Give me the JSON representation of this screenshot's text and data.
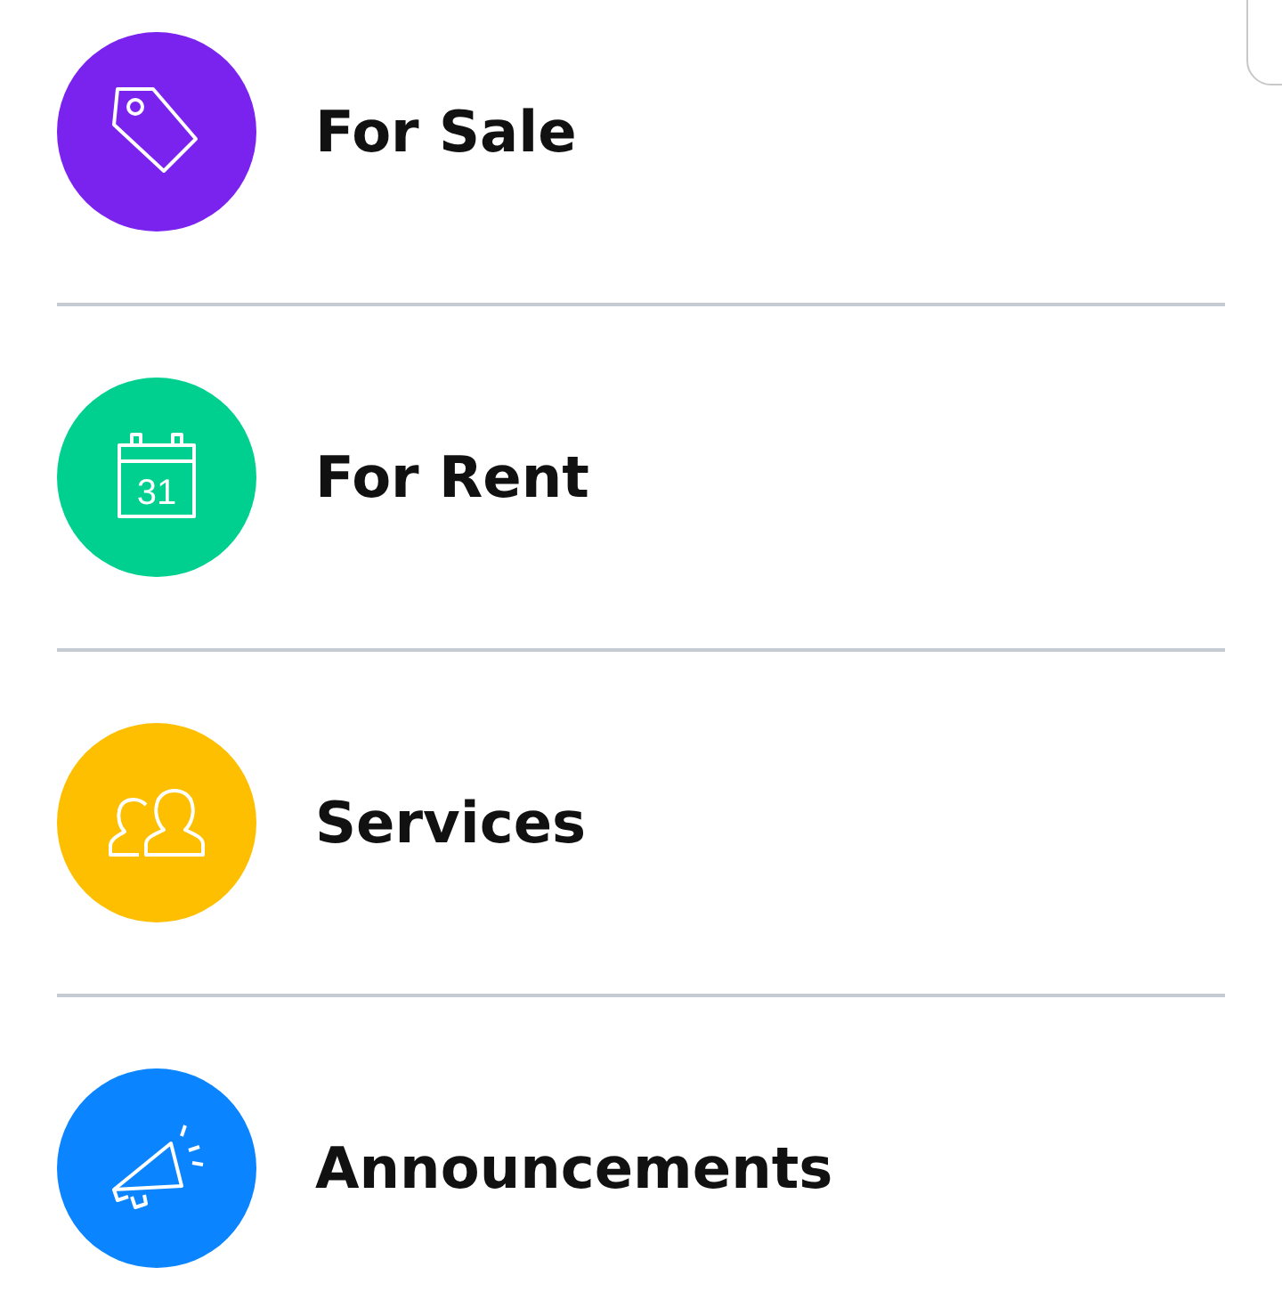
{
  "categories": [
    {
      "label": "For Sale",
      "kind": "tag",
      "color": "#7a22ee"
    },
    {
      "label": "For Rent",
      "kind": "calendar",
      "color": "#00d08f",
      "icon_label": "31"
    },
    {
      "label": "Services",
      "kind": "people",
      "color": "#fdbf00"
    },
    {
      "label": "Announcements",
      "kind": "megaphone",
      "color": "#0a84ff"
    }
  ]
}
